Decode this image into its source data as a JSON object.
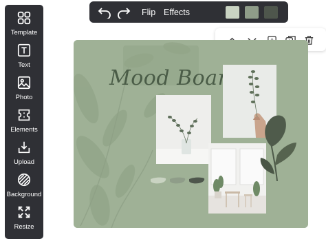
{
  "sidebar": {
    "items": [
      {
        "label": "Template",
        "icon": "template-icon"
      },
      {
        "label": "Text",
        "icon": "text-icon"
      },
      {
        "label": "Photo",
        "icon": "photo-icon"
      },
      {
        "label": "Elements",
        "icon": "elements-icon"
      },
      {
        "label": "Upload",
        "icon": "upload-icon"
      },
      {
        "label": "Background",
        "icon": "background-icon"
      },
      {
        "label": "Resize",
        "icon": "resize-icon"
      }
    ]
  },
  "topbar": {
    "undo_icon": "undo-icon",
    "redo_icon": "redo-icon",
    "flip_label": "Flip",
    "effects_label": "Effects",
    "swatches": [
      "#c9d3c2",
      "#8f9d89",
      "#4e564c"
    ]
  },
  "element_toolbar": {
    "icons": [
      "move-up-icon",
      "move-down-icon",
      "add-icon",
      "duplicate-icon",
      "delete-icon"
    ]
  },
  "canvas": {
    "title": "Mood Board",
    "background_color": "#9fb196",
    "palette_swatches": [
      "#c9d3c2",
      "#8f9d89",
      "#4e564c"
    ]
  }
}
